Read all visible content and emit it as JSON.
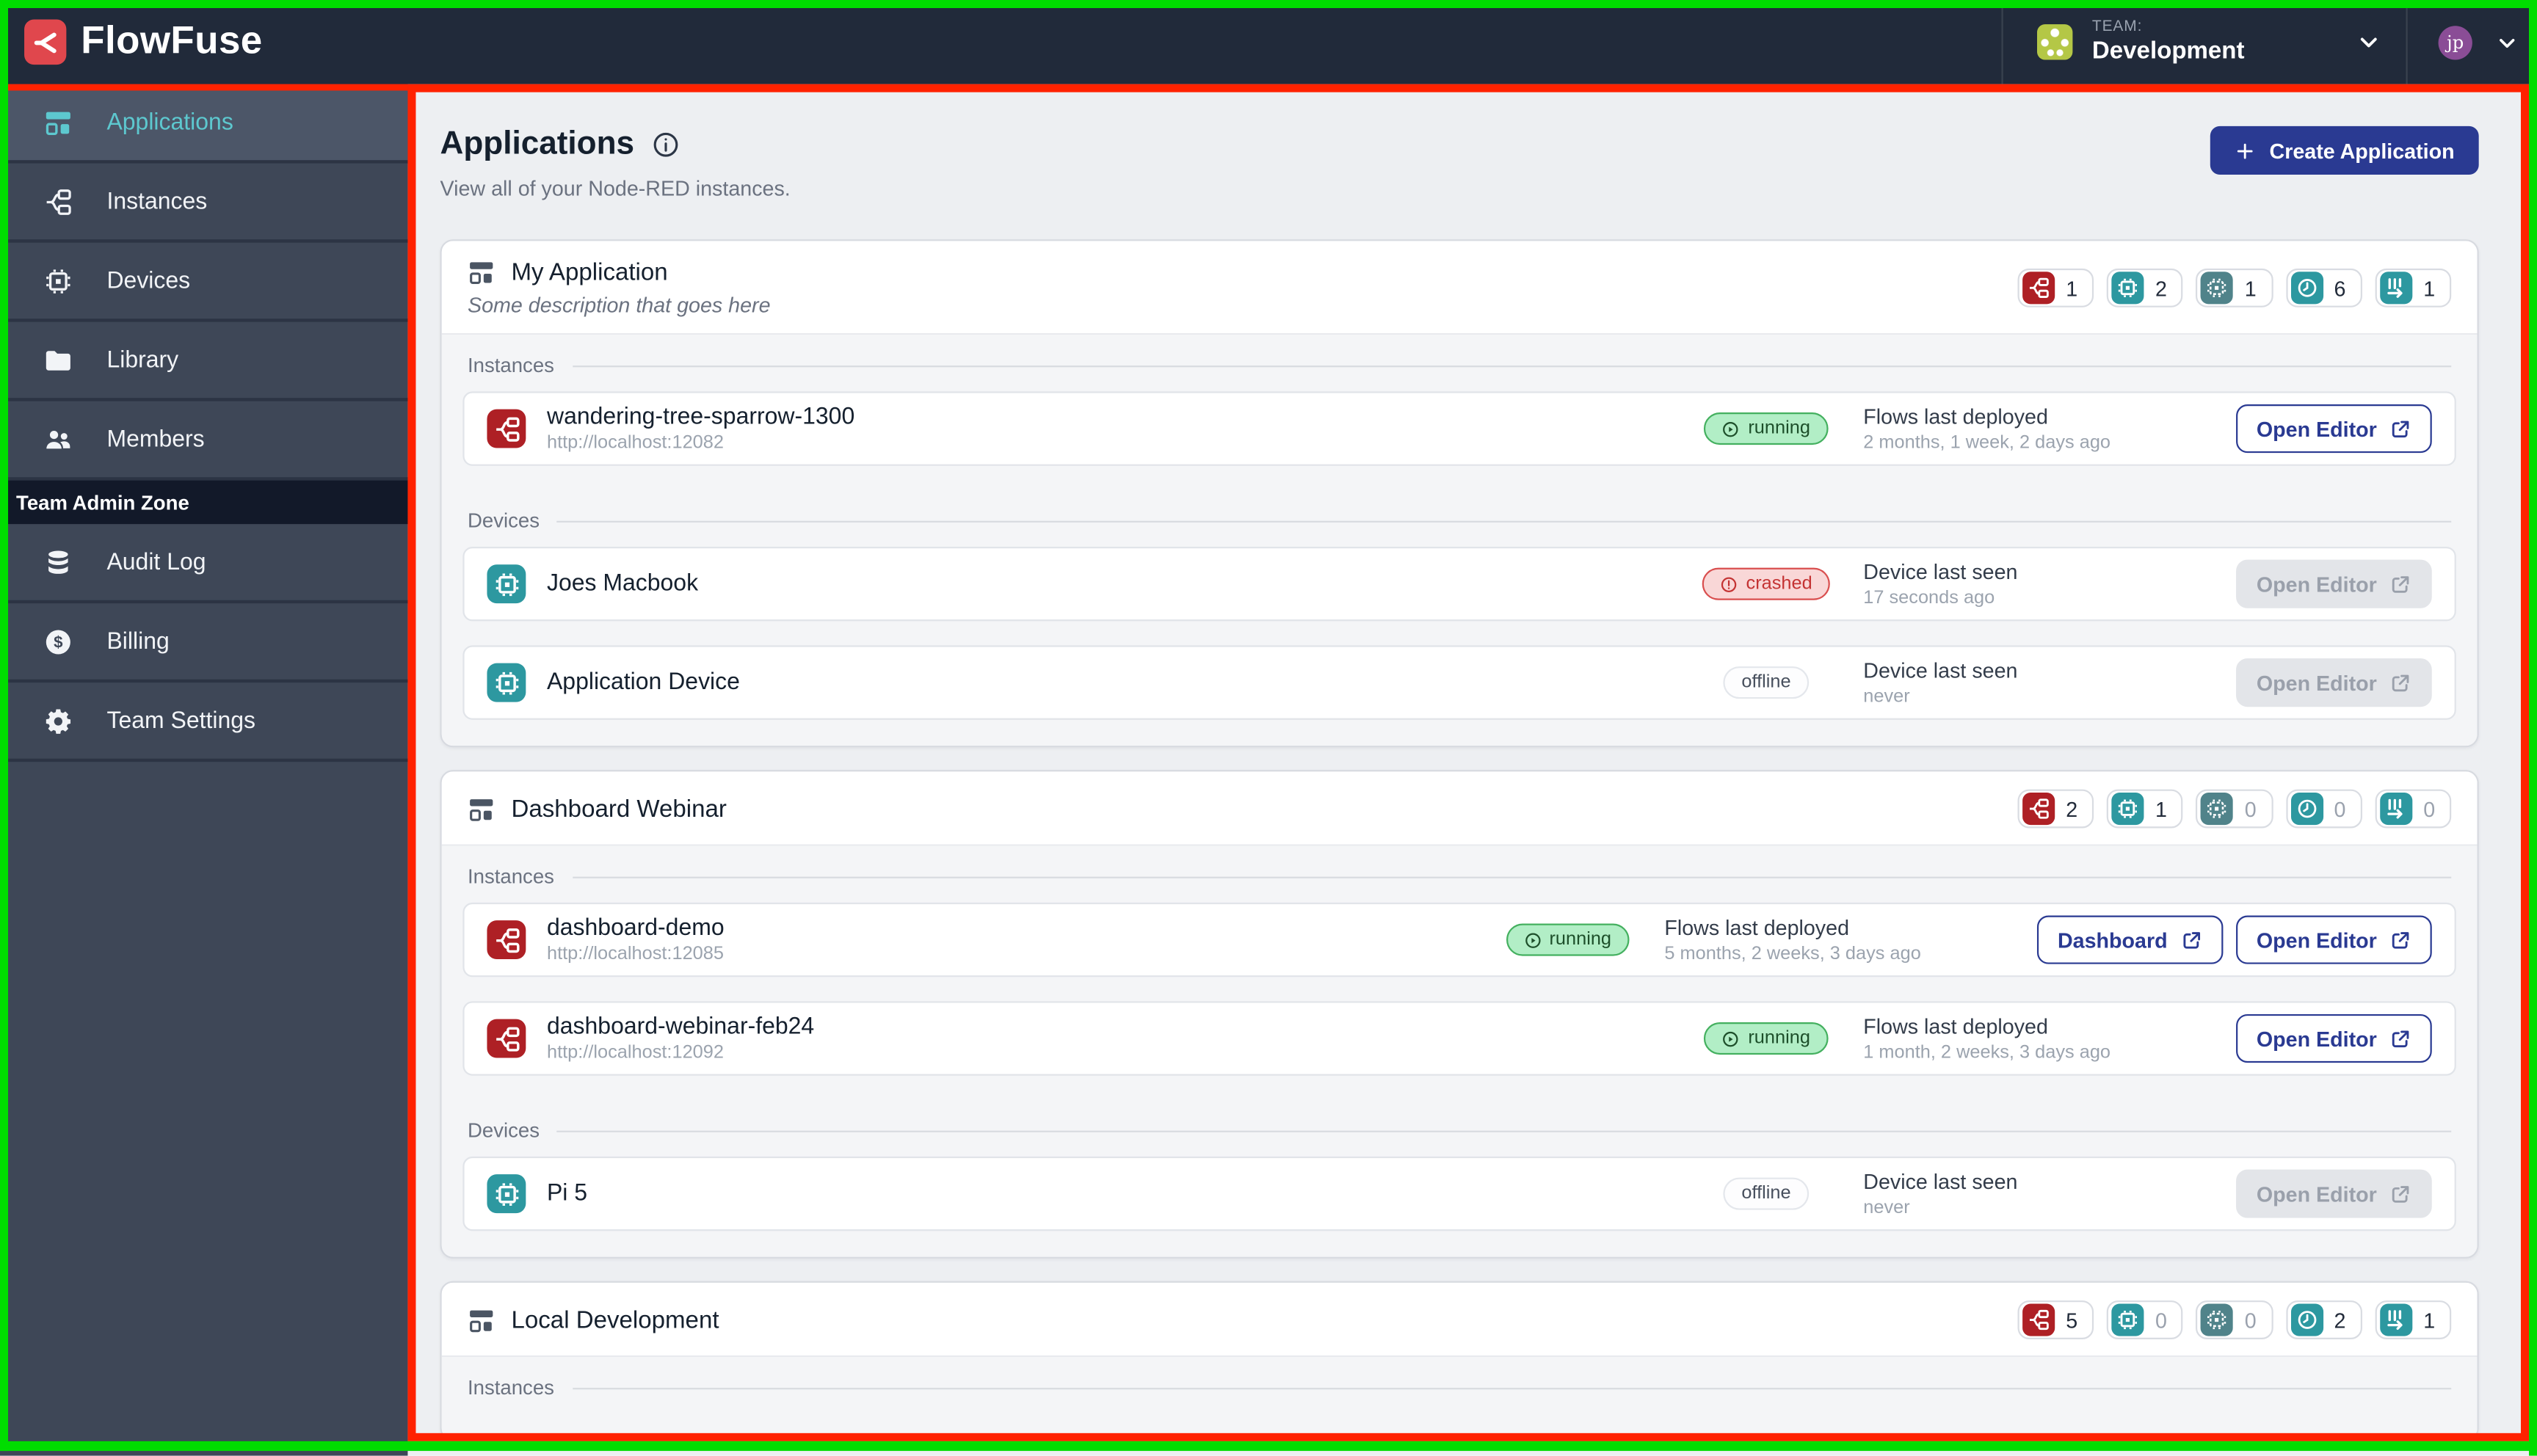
{
  "annotations": {
    "frame_color": "#00dd00",
    "highlight_color": "#ff2200"
  },
  "navbar": {
    "logo_text": "FlowFuse",
    "team_label": "TEAM:",
    "team_name": "Development",
    "user_initials": "jp"
  },
  "sidebar": {
    "items": [
      {
        "label": "Applications",
        "icon": "applications-icon",
        "active": true
      },
      {
        "label": "Instances",
        "icon": "instances-icon",
        "active": false
      },
      {
        "label": "Devices",
        "icon": "devices-icon",
        "active": false
      },
      {
        "label": "Library",
        "icon": "library-icon",
        "active": false
      },
      {
        "label": "Members",
        "icon": "members-icon",
        "active": false
      }
    ],
    "admin_section_label": "Team Admin Zone",
    "admin_items": [
      {
        "label": "Audit Log",
        "icon": "audit-log-icon"
      },
      {
        "label": "Billing",
        "icon": "billing-icon"
      },
      {
        "label": "Team Settings",
        "icon": "settings-icon"
      }
    ]
  },
  "page": {
    "title": "Applications",
    "subtitle": "View all of your Node-RED instances.",
    "create_button_label": "Create Application"
  },
  "badge_defs": [
    {
      "name": "instances-count",
      "icon": "node-red-icon",
      "color": "#ae2025"
    },
    {
      "name": "devices-count",
      "icon": "device-icon",
      "color": "#2d98a0"
    },
    {
      "name": "device-groups-count",
      "icon": "device-group-icon",
      "color": "#50838a"
    },
    {
      "name": "snapshots-count",
      "icon": "snapshots-icon",
      "color": "#2d98a0"
    },
    {
      "name": "pipelines-count",
      "icon": "pipelines-icon",
      "color": "#2d98a0"
    }
  ],
  "status_colors": {
    "running": {
      "bg": "#b2eec6",
      "border": "#44b05f",
      "text": "#1d4f2a"
    },
    "crashed": {
      "bg": "#f9d7d7",
      "border": "#d94f4f",
      "text": "#c43333"
    },
    "offline": {
      "bg": "#fdfdfe",
      "border": "#e4e7ec",
      "text": "#474f5d"
    }
  },
  "applications": [
    {
      "name": "My Application",
      "description": "Some description that goes here",
      "counts": [
        "1",
        "2",
        "1",
        "6",
        "1"
      ],
      "sections": [
        {
          "label": "Instances",
          "rows": [
            {
              "type": "instance",
              "icon": "node-red-icon",
              "icon_color": "#ae2025",
              "name": "wandering-tree-sparrow-1300",
              "url": "http://localhost:12082",
              "status": "running",
              "meta_title": "Flows last deployed",
              "meta_value": "2 months, 1 week, 2 days ago",
              "buttons": [
                {
                  "label": "Open Editor",
                  "disabled": false
                }
              ]
            }
          ]
        },
        {
          "label": "Devices",
          "rows": [
            {
              "type": "device",
              "icon": "device-icon",
              "icon_color": "#2d98a0",
              "name": "Joes Macbook",
              "status": "crashed",
              "meta_title": "Device last seen",
              "meta_value": "17 seconds ago",
              "buttons": [
                {
                  "label": "Open Editor",
                  "disabled": true
                }
              ]
            },
            {
              "type": "device",
              "icon": "device-icon",
              "icon_color": "#2d98a0",
              "name": "Application Device",
              "status": "offline",
              "meta_title": "Device last seen",
              "meta_value": "never",
              "buttons": [
                {
                  "label": "Open Editor",
                  "disabled": true
                }
              ]
            }
          ]
        }
      ]
    },
    {
      "name": "Dashboard Webinar",
      "description": "",
      "counts": [
        "2",
        "1",
        "0",
        "0",
        "0"
      ],
      "sections": [
        {
          "label": "Instances",
          "rows": [
            {
              "type": "instance",
              "icon": "node-red-icon",
              "icon_color": "#ae2025",
              "name": "dashboard-demo",
              "url": "http://localhost:12085",
              "status": "running",
              "meta_title": "Flows last deployed",
              "meta_value": "5 months, 2 weeks, 3 days ago",
              "buttons": [
                {
                  "label": "Dashboard",
                  "disabled": false
                },
                {
                  "label": "Open Editor",
                  "disabled": false
                }
              ]
            },
            {
              "type": "instance",
              "icon": "node-red-icon",
              "icon_color": "#ae2025",
              "name": "dashboard-webinar-feb24",
              "url": "http://localhost:12092",
              "status": "running",
              "meta_title": "Flows last deployed",
              "meta_value": "1 month, 2 weeks, 3 days ago",
              "buttons": [
                {
                  "label": "Open Editor",
                  "disabled": false
                }
              ]
            }
          ]
        },
        {
          "label": "Devices",
          "rows": [
            {
              "type": "device",
              "icon": "device-icon",
              "icon_color": "#2d98a0",
              "name": "Pi 5",
              "status": "offline",
              "meta_title": "Device last seen",
              "meta_value": "never",
              "buttons": [
                {
                  "label": "Open Editor",
                  "disabled": true
                }
              ]
            }
          ]
        }
      ]
    },
    {
      "name": "Local Development",
      "description": "",
      "counts": [
        "5",
        "0",
        "0",
        "2",
        "1"
      ],
      "sections": [
        {
          "label": "Instances",
          "rows": []
        }
      ]
    }
  ]
}
